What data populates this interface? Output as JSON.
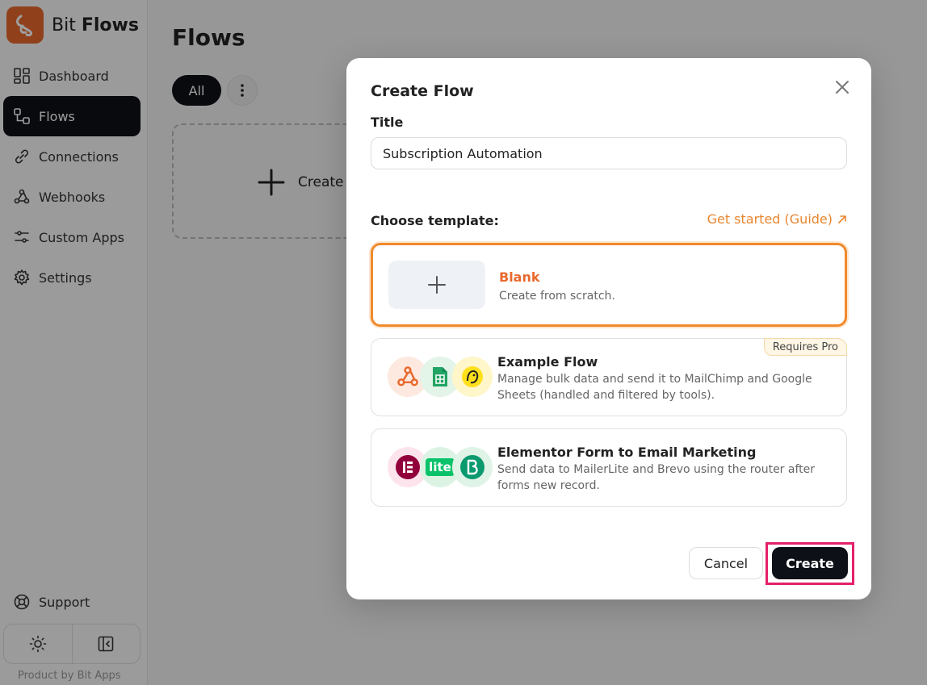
{
  "brand": {
    "name_regular": "Bit",
    "name_bold": "Flows"
  },
  "sidebar": {
    "items": [
      {
        "label": "Dashboard",
        "icon": "dashboard-icon"
      },
      {
        "label": "Flows",
        "icon": "flows-icon",
        "active": true
      },
      {
        "label": "Connections",
        "icon": "link-icon"
      },
      {
        "label": "Webhooks",
        "icon": "webhook-icon"
      },
      {
        "label": "Custom Apps",
        "icon": "sliders-icon"
      },
      {
        "label": "Settings",
        "icon": "gear-icon"
      }
    ],
    "support_label": "Support",
    "product_label": "Product by Bit Apps"
  },
  "main": {
    "title": "Flows",
    "filter_all": "All",
    "create_card_label": "Create F"
  },
  "modal": {
    "title": "Create Flow",
    "title_label": "Title",
    "title_value": "Subscription Automation",
    "choose_template_label": "Choose template:",
    "guide_link": "Get started (Guide)",
    "templates": [
      {
        "name": "Blank",
        "description": "Create from scratch."
      },
      {
        "name": "Example Flow",
        "description": "Manage bulk data and send it to MailChimp and Google Sheets (handled and filtered by tools).",
        "badge": "Requires Pro"
      },
      {
        "name": "Elementor Form to Email Marketing",
        "description": "Send data to MailerLite and Brevo using the router after forms new record.",
        "icon_text_lite": "lite"
      }
    ],
    "cancel_label": "Cancel",
    "create_label": "Create"
  },
  "colors": {
    "accent": "#e8692e",
    "primary_dark": "#0d1117",
    "highlight": "#e5206a"
  }
}
